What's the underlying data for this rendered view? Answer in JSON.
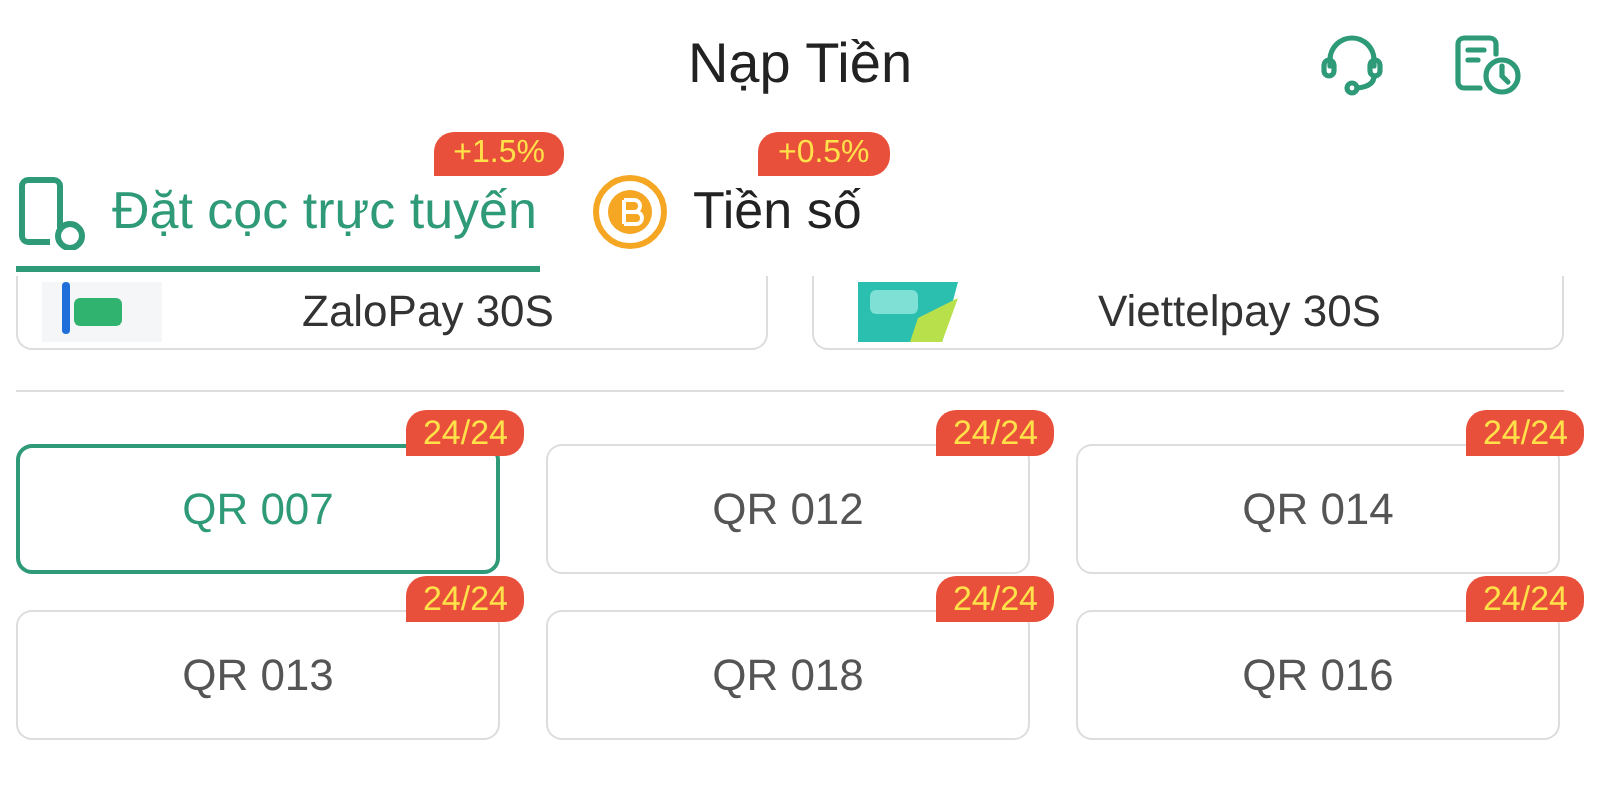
{
  "header": {
    "title": "Nạp Tiền"
  },
  "tabs": [
    {
      "label": "Đặt cọc trực tuyến",
      "badge": "+1.5%",
      "kind": "phone",
      "selected": true
    },
    {
      "label": "Tiền số",
      "badge": "+0.5%",
      "kind": "coin",
      "selected": false
    }
  ],
  "payment_methods": [
    {
      "name": "ZaloPay 30S",
      "kind": "zalopay"
    },
    {
      "name": "Viettelpay 30S",
      "kind": "viettelpay"
    }
  ],
  "qr_options": [
    {
      "label": "QR 007",
      "badge": "24/24",
      "selected": true
    },
    {
      "label": "QR 012",
      "badge": "24/24",
      "selected": false
    },
    {
      "label": "QR 014",
      "badge": "24/24",
      "selected": false
    },
    {
      "label": "QR 013",
      "badge": "24/24",
      "selected": false
    },
    {
      "label": "QR 018",
      "badge": "24/24",
      "selected": false
    },
    {
      "label": "QR 016",
      "badge": "24/24",
      "selected": false
    }
  ]
}
